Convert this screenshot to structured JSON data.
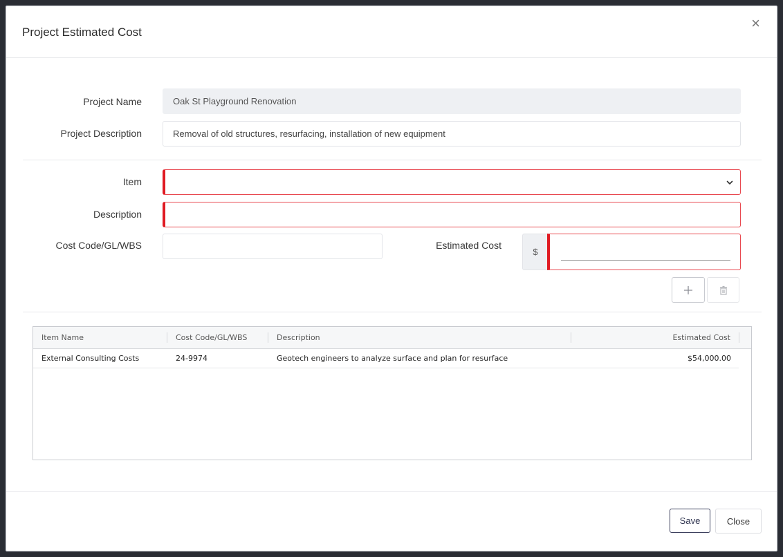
{
  "modal": {
    "title": "Project Estimated Cost",
    "close_glyph": "×"
  },
  "form": {
    "project_name_label": "Project Name",
    "project_name_value": "Oak St Playground Renovation",
    "project_description_label": "Project Description",
    "project_description_value": "Removal of old structures, resurfacing, installation of new equipment",
    "item_label": "Item",
    "item_value": "",
    "description_label": "Description",
    "description_value": "",
    "cost_code_label": "Cost Code/GL/WBS",
    "cost_code_value": "",
    "estimated_cost_label": "Estimated Cost",
    "currency_symbol": "$",
    "estimated_cost_value": ""
  },
  "actions": {
    "add_icon": "plus-icon",
    "delete_icon": "trash-icon"
  },
  "grid": {
    "columns": [
      "Item Name",
      "Cost Code/GL/WBS",
      "Description",
      "Estimated Cost"
    ],
    "rows": [
      {
        "item_name": "External Consulting Costs",
        "cost_code": "24-9974",
        "description": "Geotech engineers to analyze surface and plan for resurface",
        "estimated_cost": "$54,000.00"
      }
    ]
  },
  "footer": {
    "save_label": "Save",
    "close_label": "Close"
  },
  "colors": {
    "invalid_border": "#e01b23",
    "primary_button_border": "#3b3f5c"
  }
}
